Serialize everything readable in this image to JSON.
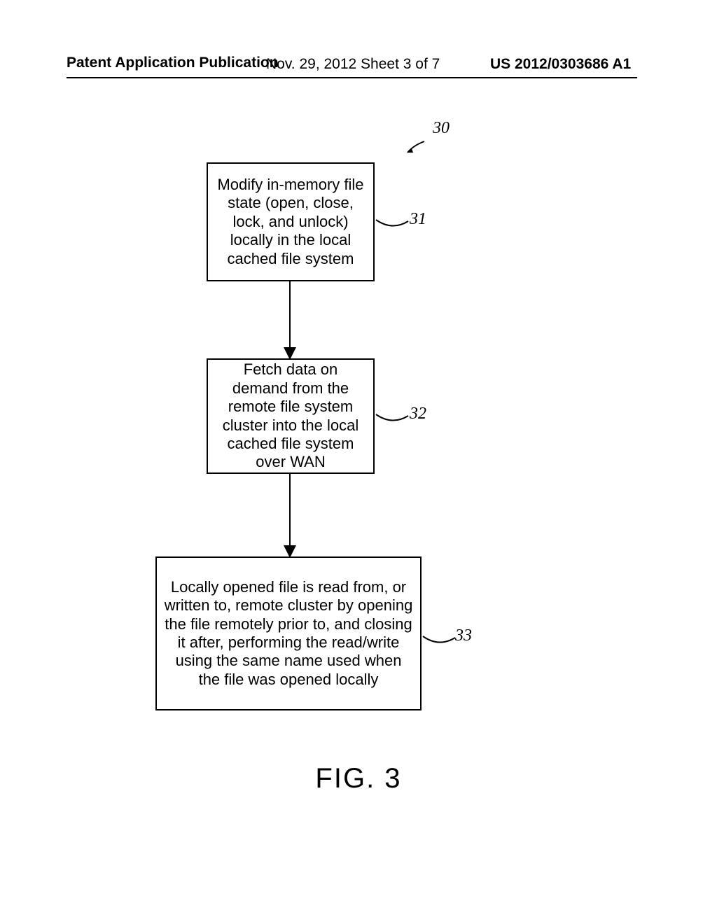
{
  "header": {
    "left": "Patent Application Publication",
    "center": "Nov. 29, 2012  Sheet 3 of 7",
    "right": "US 2012/0303686 A1"
  },
  "refs": {
    "overall": "30",
    "box1": "31",
    "box2": "32",
    "box3": "33"
  },
  "boxes": {
    "b1": "Modify in-memory file state (open, close, lock, and unlock) locally in the local cached file system",
    "b2": "Fetch data on demand from the remote file system cluster into the local cached file system over WAN",
    "b3": "Locally opened file is read from, or written to, remote cluster by opening the file remotely prior to, and closing it after, performing the read/write using the same name used when the file was opened locally"
  },
  "figure_label": "FIG. 3",
  "chart_data": {
    "type": "flowchart",
    "caption": "FIG. 3",
    "overall_ref": "30",
    "nodes": [
      {
        "id": "31",
        "text": "Modify in-memory file state (open, close, lock, and unlock) locally in the local cached file system"
      },
      {
        "id": "32",
        "text": "Fetch data on demand from the remote file system cluster into the local cached file system over WAN"
      },
      {
        "id": "33",
        "text": "Locally opened file is read from, or written to, remote cluster by opening the file remotely prior to, and closing it after, performing the read/write using the same name used when the file was opened locally"
      }
    ],
    "edges": [
      {
        "from": "31",
        "to": "32"
      },
      {
        "from": "32",
        "to": "33"
      }
    ]
  }
}
